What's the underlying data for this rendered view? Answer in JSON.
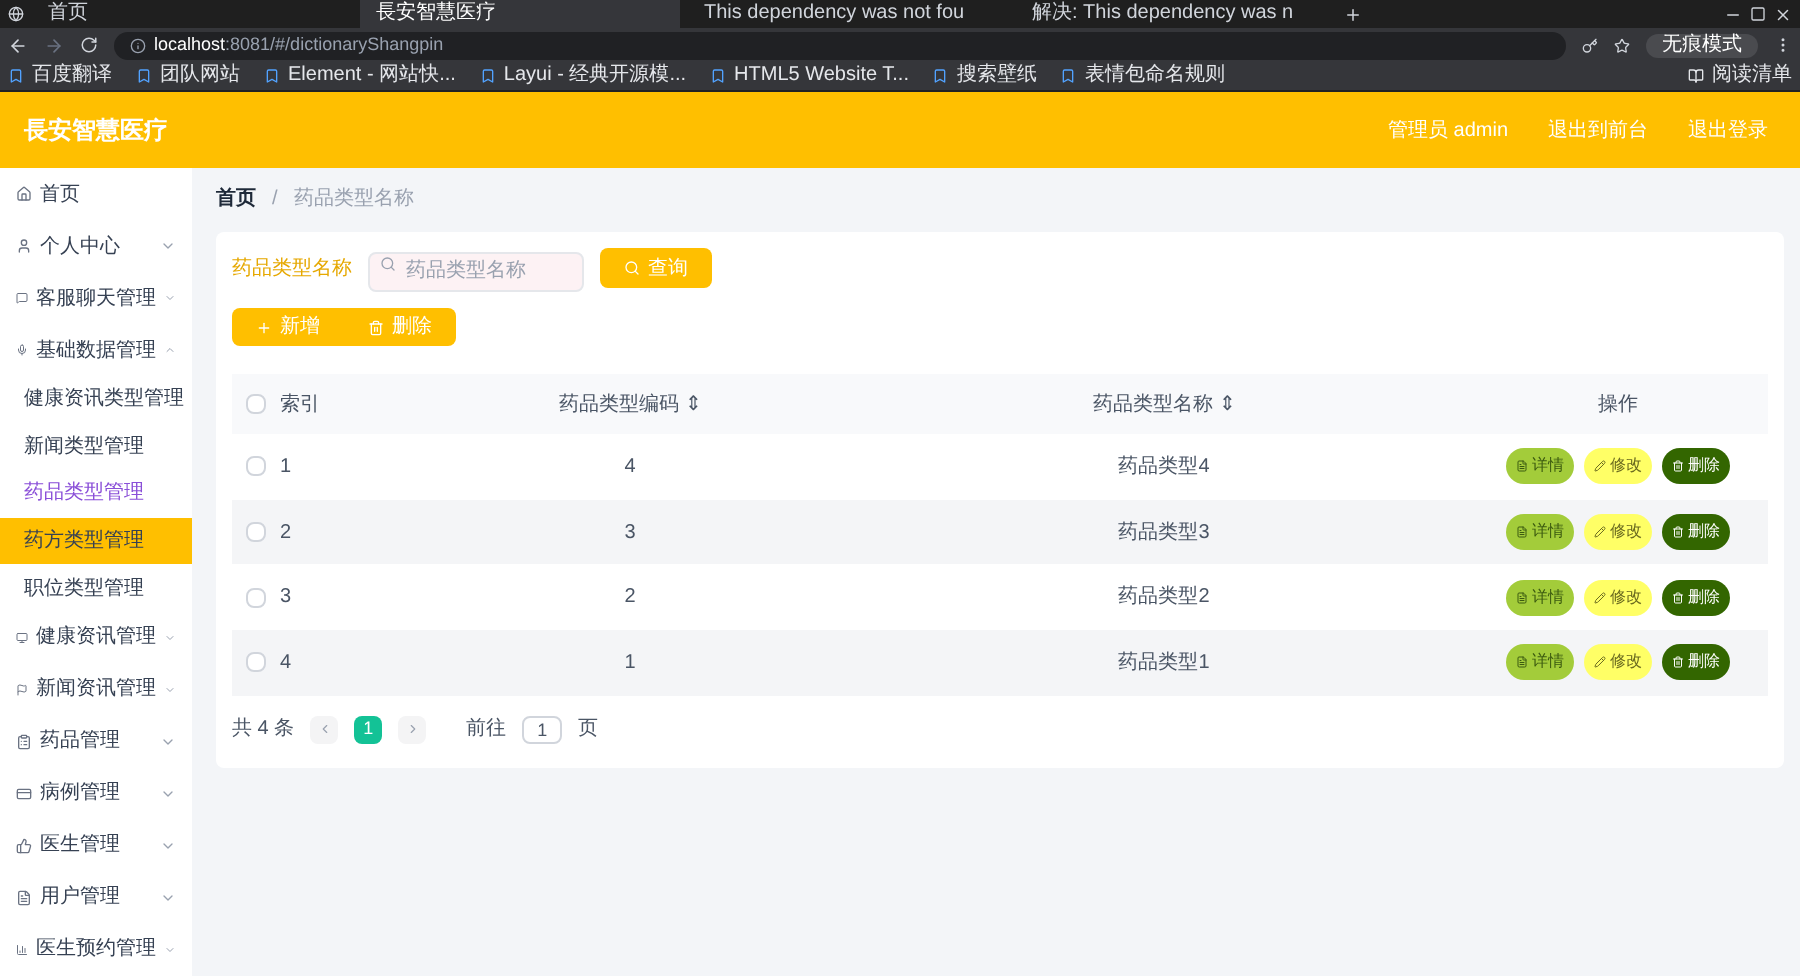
{
  "browser": {
    "tabs": [
      {
        "title": "首页",
        "selected": false
      },
      {
        "title": "長安智慧医疗",
        "selected": true
      },
      {
        "title": "This dependency was not fou",
        "selected": false
      },
      {
        "title": "解决: This dependency was n",
        "selected": false
      }
    ],
    "url_host": "localhost",
    "url_rest": ":8081/#/dictionaryShangpin",
    "profile": "无痕模式",
    "bookmarks": [
      "百度翻译",
      "团队网站",
      "Element - 网站快...",
      "Layui - 经典开源模...",
      "HTML5 Website T...",
      "搜索壁纸",
      "表情包命名规则"
    ],
    "reading_list": "阅读清单"
  },
  "header": {
    "title": "長安智慧医疗",
    "links": [
      "管理员 admin",
      "退出到前台",
      "退出登录"
    ]
  },
  "sidebar": {
    "items": [
      {
        "label": "首页"
      },
      {
        "label": "个人中心",
        "expanded": false
      },
      {
        "label": "客服聊天管理",
        "expanded": false
      },
      {
        "label": "基础数据管理",
        "expanded": true,
        "children": [
          {
            "label": "健康资讯类型管理",
            "selected": false,
            "highlighted": false
          },
          {
            "label": "新闻类型管理",
            "selected": false,
            "highlighted": false
          },
          {
            "label": "药品类型管理",
            "selected": true,
            "highlighted": false
          },
          {
            "label": "药方类型管理",
            "selected": false,
            "highlighted": true
          },
          {
            "label": "职位类型管理",
            "selected": false,
            "highlighted": false
          }
        ]
      },
      {
        "label": "健康资讯管理",
        "expanded": false
      },
      {
        "label": "新闻资讯管理",
        "expanded": false
      },
      {
        "label": "药品管理",
        "expanded": false
      },
      {
        "label": "病例管理",
        "expanded": false
      },
      {
        "label": "医生管理",
        "expanded": false
      },
      {
        "label": "用户管理",
        "expanded": false
      },
      {
        "label": "医生预约管理",
        "expanded": false
      }
    ]
  },
  "breadcrumb": {
    "items": [
      "首页",
      "药品类型名称"
    ],
    "separator": "/"
  },
  "search": {
    "label": "药品类型名称",
    "placeholder": "药品类型名称",
    "button": "查询"
  },
  "actions": [
    "新增",
    "删除"
  ],
  "table": {
    "select_all_checked": false,
    "columns": [
      "索引",
      "药品类型编码",
      "药品类型名称",
      "操作"
    ],
    "sort_marks": [
      "⇕",
      "⇕"
    ],
    "rows": [
      {
        "checked": false,
        "index": "1",
        "code": "4",
        "name": "药品类型4",
        "buttons": [
          "详情",
          "修改",
          "删除"
        ]
      },
      {
        "checked": false,
        "index": "2",
        "code": "3",
        "name": "药品类型3",
        "buttons": [
          "详情",
          "修改",
          "删除"
        ]
      },
      {
        "checked": false,
        "index": "3",
        "code": "2",
        "name": "药品类型2",
        "buttons": [
          "详情",
          "修改",
          "删除"
        ]
      },
      {
        "checked": false,
        "index": "4",
        "code": "1",
        "name": "药品类型1",
        "buttons": [
          "详情",
          "修改",
          "删除"
        ]
      }
    ]
  },
  "pagination": {
    "total": "共 4 条",
    "pages": [
      {
        "label": "1",
        "selected": true
      }
    ],
    "goto": "前往",
    "page_value": "1",
    "page_suffix": "页"
  }
}
